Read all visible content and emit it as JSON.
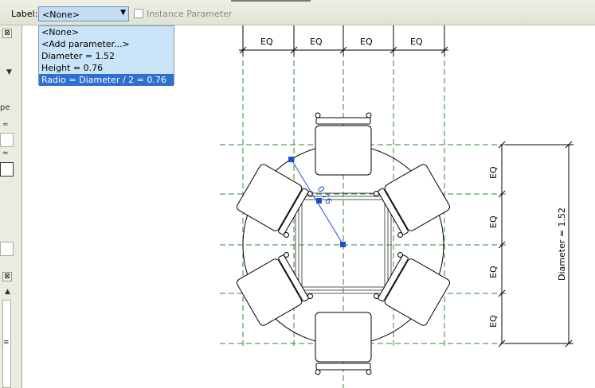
{
  "toolbar": {
    "label_caption": "Label:",
    "label_value": "<None>",
    "instance_parameter": "Instance Parameter"
  },
  "dropdown": {
    "items": [
      {
        "label": "<None>",
        "selected": false
      },
      {
        "label": "<Add parameter...>",
        "selected": false
      },
      {
        "label": "Diameter = 1.52",
        "selected": false
      },
      {
        "label": "Height = 0.76",
        "selected": false
      },
      {
        "label": "Radio = Diameter / 2 = 0.76",
        "selected": true
      }
    ]
  },
  "left_panel": {
    "partial_text": "pe",
    "close_glyph": "⊠",
    "chevron_up": "≈",
    "scroll_grip": "≡"
  },
  "drawing": {
    "eq_label": "EQ",
    "diameter_label": "Diameter = 1.52",
    "radius_value": "0.76"
  },
  "colors": {
    "reference_line": "#2e8b2e",
    "selection": "#1f4fd0",
    "selected_item_bg": "#2f6fd0",
    "dropdown_bg": "#c9e4f8"
  }
}
